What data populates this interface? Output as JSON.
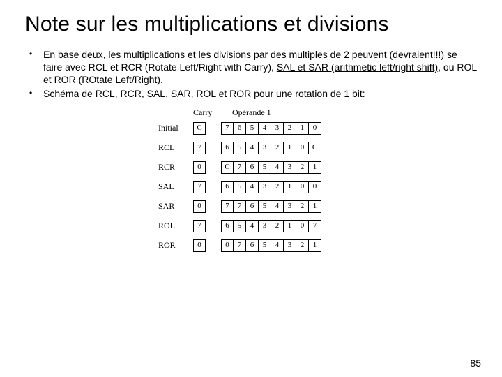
{
  "title": "Note sur les multiplications et divisions",
  "bullets": {
    "b1_pre": "En base deux, les multiplications et les divisions par des multiples de 2 peuvent (devraient!!!) se faire avec RCL et RCR (Rotate Left/Right with Carry), ",
    "b1_ul": "SAL et SAR (arithmetic left/right shift)",
    "b1_post": ", ou ROL et ROR (ROtate Left/Right).",
    "b2": "Schéma de RCL, RCR, SAL, SAR, ROL et ROR pour une rotation de 1 bit:"
  },
  "headers": {
    "carry": "Carry",
    "operand": "Opérande 1"
  },
  "rows": [
    {
      "label": "Initial",
      "carry": "C",
      "bits": [
        "7",
        "6",
        "5",
        "4",
        "3",
        "2",
        "1",
        "0"
      ]
    },
    {
      "label": "RCL",
      "carry": "7",
      "bits": [
        "6",
        "5",
        "4",
        "3",
        "2",
        "1",
        "0",
        "C"
      ]
    },
    {
      "label": "RCR",
      "carry": "0",
      "bits": [
        "C",
        "7",
        "6",
        "5",
        "4",
        "3",
        "2",
        "1"
      ]
    },
    {
      "label": "SAL",
      "carry": "7",
      "bits": [
        "6",
        "5",
        "4",
        "3",
        "2",
        "1",
        "0",
        "0"
      ]
    },
    {
      "label": "SAR",
      "carry": "0",
      "bits": [
        "7",
        "7",
        "6",
        "5",
        "4",
        "3",
        "2",
        "1"
      ]
    },
    {
      "label": "ROL",
      "carry": "7",
      "bits": [
        "6",
        "5",
        "4",
        "3",
        "2",
        "1",
        "0",
        "7"
      ]
    },
    {
      "label": "ROR",
      "carry": "0",
      "bits": [
        "0",
        "7",
        "6",
        "5",
        "4",
        "3",
        "2",
        "1"
      ]
    }
  ],
  "page": "85"
}
